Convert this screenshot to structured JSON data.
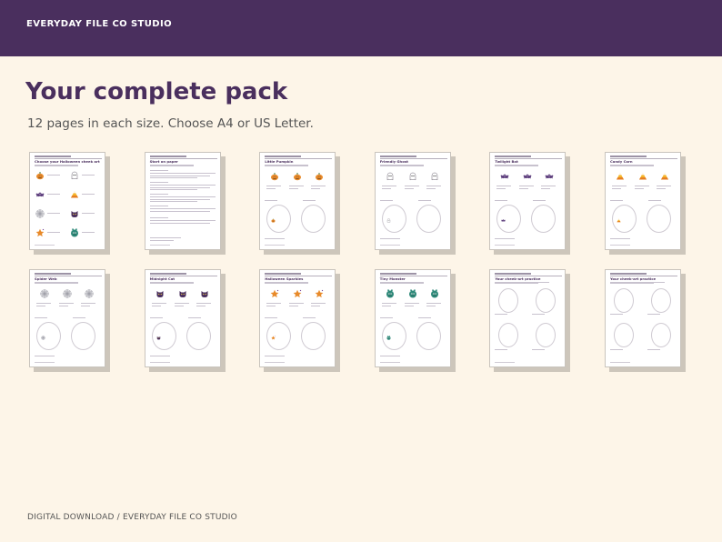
{
  "header": {
    "brand": "EVERYDAY FILE CO STUDIO"
  },
  "main": {
    "title": "Your complete pack",
    "subtitle": "12 pages in each size. Choose A4 or US Letter."
  },
  "colors": {
    "header_bg": "#4a2f5e",
    "page_bg": "#fdf5e8",
    "accent": "#4a2f5e"
  },
  "thumbnails": [
    {
      "title": "Choose your Halloween cheek art",
      "kind": "menu",
      "icons": [
        "pumpkin-icon",
        "ghost-icon",
        "bat-icon",
        "candy-corn-icon",
        "spider-web-icon",
        "cat-icon",
        "star-icon",
        "monster-icon"
      ]
    },
    {
      "title": "Start on paper",
      "kind": "text",
      "icons": []
    },
    {
      "title": "Little Pumpkin",
      "kind": "practice",
      "icons": [
        "pumpkin-icon"
      ]
    },
    {
      "title": "Friendly Ghost",
      "kind": "practice",
      "icons": [
        "ghost-icon"
      ]
    },
    {
      "title": "Twilight Bat",
      "kind": "practice",
      "icons": [
        "bat-icon"
      ]
    },
    {
      "title": "Candy Corn",
      "kind": "practice",
      "icons": [
        "candy-corn-icon"
      ]
    },
    {
      "title": "Spider Web",
      "kind": "practice",
      "icons": [
        "spider-web-icon"
      ]
    },
    {
      "title": "Midnight Cat",
      "kind": "practice",
      "icons": [
        "cat-icon"
      ]
    },
    {
      "title": "Halloween Sparkles",
      "kind": "practice",
      "icons": [
        "star-icon"
      ]
    },
    {
      "title": "Tiny Monster",
      "kind": "practice",
      "icons": [
        "monster-icon"
      ]
    },
    {
      "title": "Your cheek-art practice",
      "kind": "blank",
      "icons": []
    },
    {
      "title": "Your cheek-art practice",
      "kind": "blank",
      "icons": []
    }
  ],
  "footer": {
    "text": "DIGITAL DOWNLOAD / EVERYDAY FILE CO STUDIO"
  }
}
